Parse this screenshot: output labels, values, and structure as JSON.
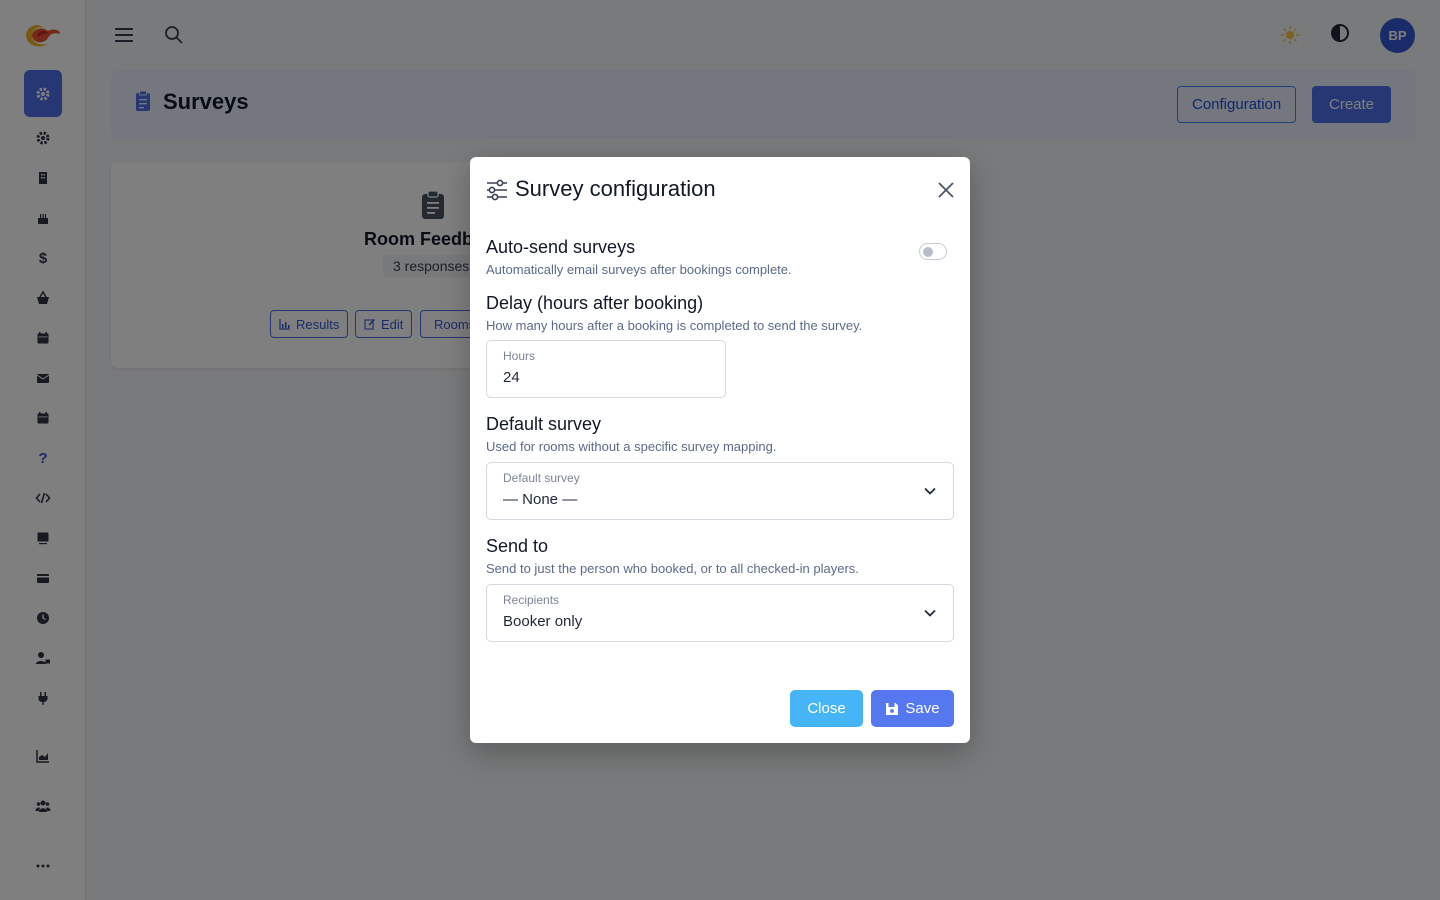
{
  "app": {
    "sidebar_items": [
      "gear-icon",
      "building-icon",
      "cake-icon",
      "dollar-icon",
      "basket-icon",
      "calendar-icon",
      "envelope-icon",
      "calendar-alt-icon",
      "question-icon",
      "code-icon",
      "monitor-icon",
      "credit-card-icon",
      "clock-icon",
      "user-lock-icon",
      "plug-icon",
      "chart-icon",
      "users-icon",
      "ellipsis-icon"
    ],
    "help_glyph": "?",
    "dollar_glyph": "$"
  },
  "topbar": {
    "avatar_initials": "BP"
  },
  "header": {
    "title": "Surveys",
    "configuration_label": "Configuration",
    "create_label": "Create"
  },
  "survey_card": {
    "title": "Room Feedback",
    "responses": "3 responses",
    "results_label": "Results",
    "edit_label": "Edit",
    "rooms_label": "Rooms"
  },
  "modal": {
    "title": "Survey configuration",
    "auto_send": {
      "title": "Auto-send surveys",
      "help": "Automatically email surveys after bookings complete.",
      "enabled": false
    },
    "delay": {
      "title": "Delay (hours after booking)",
      "help": "How many hours after a booking is completed to send the survey.",
      "field_label": "Hours",
      "value": "24"
    },
    "default_survey": {
      "title": "Default survey",
      "help": "Used for rooms without a specific survey mapping.",
      "field_label": "Default survey",
      "value": "— None —"
    },
    "send_to": {
      "title": "Send to",
      "help": "Send to just the person who booked, or to all checked-in players.",
      "field_label": "Recipients",
      "value": "Booker only"
    },
    "close_label": "Close",
    "save_label": "Save"
  },
  "colors": {
    "primary": "#4d6ee8",
    "info": "#45b5f7",
    "save": "#5577f0"
  }
}
